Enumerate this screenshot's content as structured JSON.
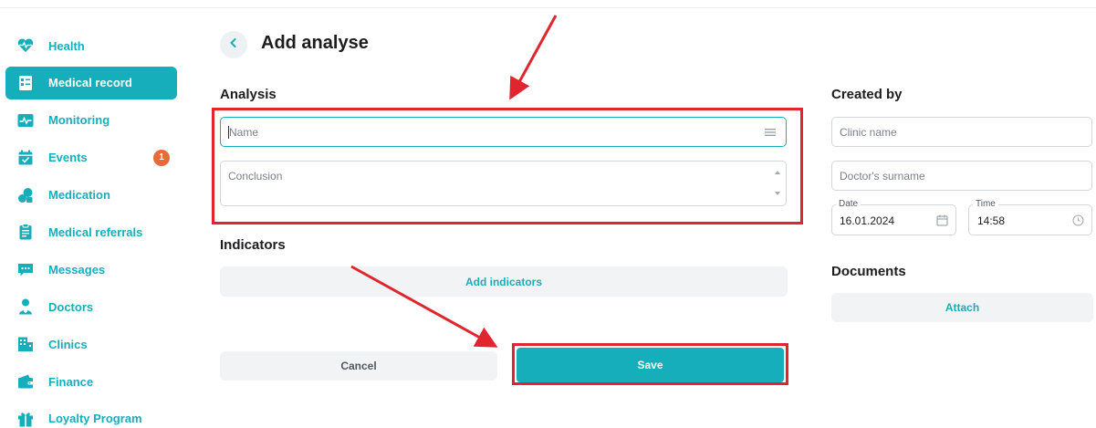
{
  "sidebar": {
    "items": [
      {
        "label": "Health",
        "icon": "heart-pulse-icon",
        "active": false
      },
      {
        "label": "Medical record",
        "icon": "medical-record-icon",
        "active": true
      },
      {
        "label": "Monitoring",
        "icon": "monitoring-icon",
        "active": false
      },
      {
        "label": "Events",
        "icon": "calendar-check-icon",
        "active": false,
        "badge": "1"
      },
      {
        "label": "Medication",
        "icon": "pills-icon",
        "active": false
      },
      {
        "label": "Medical referrals",
        "icon": "clipboard-icon",
        "active": false
      },
      {
        "label": "Messages",
        "icon": "chat-icon",
        "active": false
      },
      {
        "label": "Doctors",
        "icon": "doctor-icon",
        "active": false
      },
      {
        "label": "Clinics",
        "icon": "building-icon",
        "active": false
      },
      {
        "label": "Finance",
        "icon": "wallet-icon",
        "active": false
      },
      {
        "label": "Loyalty Program",
        "icon": "gift-icon",
        "active": false
      }
    ]
  },
  "header": {
    "title": "Add analyse"
  },
  "analysis": {
    "title": "Analysis",
    "name_placeholder": "Name",
    "conclusion_placeholder": "Conclusion"
  },
  "indicators": {
    "title": "Indicators",
    "add_label": "Add indicators"
  },
  "actions": {
    "cancel_label": "Cancel",
    "save_label": "Save"
  },
  "created_by": {
    "title": "Created by",
    "clinic_placeholder": "Clinic name",
    "doctor_placeholder": "Doctor's surname",
    "date_label": "Date",
    "date_value": "16.01.2024",
    "time_label": "Time",
    "time_value": "14:58"
  },
  "documents": {
    "title": "Documents",
    "attach_label": "Attach"
  },
  "colors": {
    "accent": "#17aebc",
    "highlight": "#e0252f",
    "badge": "#e76a3a"
  }
}
